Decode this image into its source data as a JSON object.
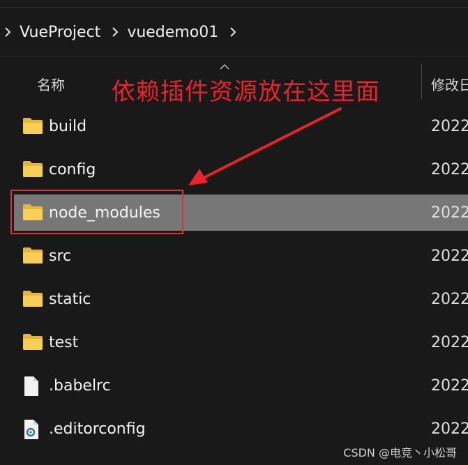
{
  "breadcrumb": {
    "items": [
      {
        "label": "VueProject"
      },
      {
        "label": "vuedemo01"
      }
    ]
  },
  "columns": {
    "name": "名称",
    "date": "修改日"
  },
  "annotation": {
    "text": "依赖插件资源放在这里面",
    "color": "#e8232b"
  },
  "files": [
    {
      "name": "build",
      "type": "folder-icon",
      "date": "2022",
      "selected": false
    },
    {
      "name": "config",
      "type": "folder-icon",
      "date": "2022",
      "selected": false
    },
    {
      "name": "node_modules",
      "type": "folder-icon",
      "date": "2022",
      "selected": true
    },
    {
      "name": "src",
      "type": "folder-icon",
      "date": "2022",
      "selected": false
    },
    {
      "name": "static",
      "type": "folder-icon",
      "date": "2022",
      "selected": false
    },
    {
      "name": "test",
      "type": "folder-icon",
      "date": "2022",
      "selected": false
    },
    {
      "name": ".babelrc",
      "type": "file-icon",
      "date": "2022",
      "selected": false
    },
    {
      "name": ".editorconfig",
      "type": "config-file-icon",
      "date": "2022",
      "selected": false
    }
  ],
  "watermark": "CSDN @电竞丶小松哥",
  "colors": {
    "background": "#191919",
    "selected_row": "#777777",
    "folder": "#f4c64a",
    "highlight_border": "#e23030"
  }
}
